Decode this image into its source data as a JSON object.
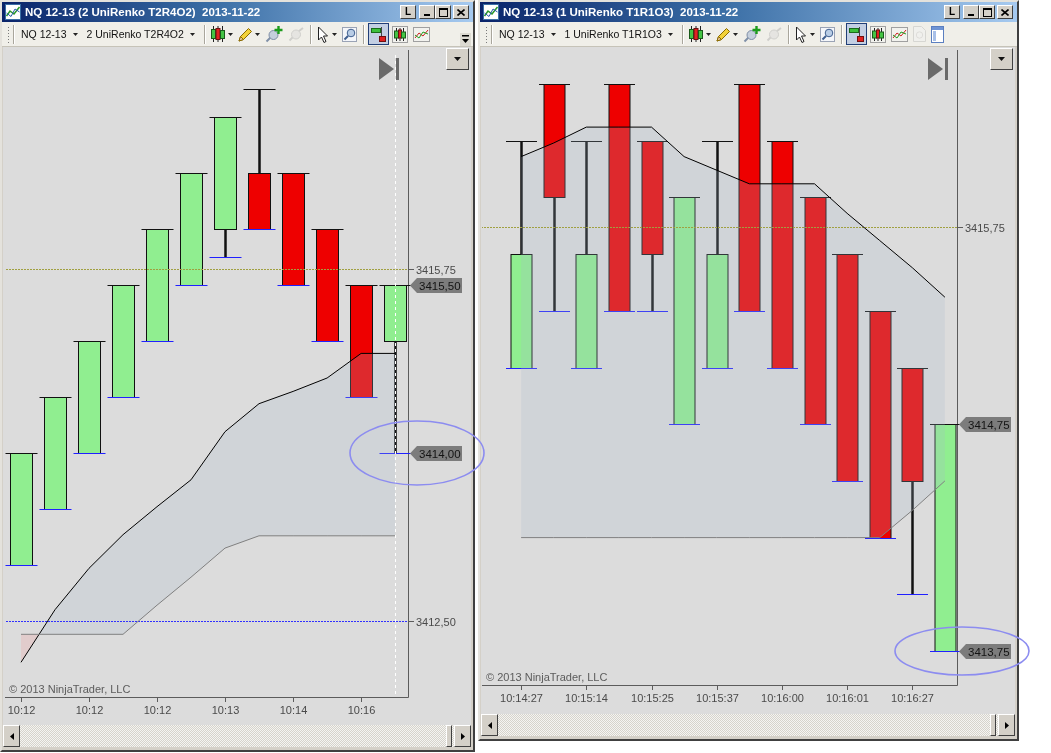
{
  "windows": [
    {
      "title": "NQ 12-13 (2 UniRenko T2R4O2)  2013-11-22",
      "title_buttons": [
        {
          "kind": "link",
          "label": "L"
        },
        {
          "kind": "minimize"
        },
        {
          "kind": "maximize"
        },
        {
          "kind": "close"
        }
      ],
      "toolbar": {
        "instrument": "NQ 12-13",
        "bar_type": "2 UniRenko T2R4O2",
        "tool_groups": [
          [
            {
              "kind": "chart-style",
              "dropdown": true,
              "selected": false,
              "disabled": false
            },
            {
              "kind": "drawing-tool",
              "dropdown": true,
              "selected": false,
              "disabled": false
            },
            {
              "kind": "add-indicator",
              "dropdown": false,
              "selected": false,
              "disabled": false
            },
            {
              "kind": "remove-indicator",
              "dropdown": false,
              "selected": false,
              "disabled": true
            }
          ],
          [
            {
              "kind": "pointer",
              "dropdown": true,
              "selected": false,
              "disabled": false
            },
            {
              "kind": "zoom",
              "dropdown": false,
              "selected": false,
              "disabled": false
            }
          ],
          [
            {
              "kind": "price-markers",
              "dropdown": false,
              "selected": true,
              "disabled": false
            },
            {
              "kind": "bar-chart",
              "dropdown": false,
              "selected": false,
              "disabled": false
            },
            {
              "kind": "line-chart",
              "dropdown": false,
              "selected": false,
              "disabled": false
            }
          ]
        ],
        "overflow_button": true
      },
      "chart": {
        "price_levels": [
          {
            "label": "3415,75",
            "color": "#a0a040"
          },
          {
            "label": "3412,50",
            "color": "#3030ff"
          }
        ],
        "price_markers": [
          "3415,50",
          "3414,00"
        ],
        "time_labels": [
          "10:12",
          "10:12",
          "10:12",
          "10:13",
          "10:14",
          "10:16"
        ],
        "copyright": "© 2013 NinjaTrader, LLC"
      }
    },
    {
      "title": "NQ 12-13 (1 UniRenko T1R1O3)  2013-11-22",
      "title_buttons": [
        {
          "kind": "link",
          "label": "L"
        },
        {
          "kind": "minimize"
        },
        {
          "kind": "maximize"
        },
        {
          "kind": "close"
        }
      ],
      "toolbar": {
        "instrument": "NQ 12-13",
        "bar_type": "1 UniRenko T1R1O3",
        "tool_groups": [
          [
            {
              "kind": "chart-style",
              "dropdown": true,
              "selected": false,
              "disabled": false
            },
            {
              "kind": "drawing-tool",
              "dropdown": true,
              "selected": false,
              "disabled": false
            },
            {
              "kind": "add-indicator",
              "dropdown": false,
              "selected": false,
              "disabled": false
            },
            {
              "kind": "remove-indicator",
              "dropdown": false,
              "selected": false,
              "disabled": true
            }
          ],
          [
            {
              "kind": "pointer",
              "dropdown": true,
              "selected": false,
              "disabled": false
            },
            {
              "kind": "zoom",
              "dropdown": false,
              "selected": false,
              "disabled": false
            }
          ],
          [
            {
              "kind": "price-markers",
              "dropdown": false,
              "selected": true,
              "disabled": false
            },
            {
              "kind": "bar-chart",
              "dropdown": false,
              "selected": false,
              "disabled": false
            },
            {
              "kind": "line-chart",
              "dropdown": false,
              "selected": false,
              "disabled": false
            },
            {
              "kind": "document",
              "dropdown": false,
              "selected": false,
              "disabled": true
            },
            {
              "kind": "panel",
              "dropdown": false,
              "selected": false,
              "disabled": false
            }
          ]
        ],
        "overflow_button": false
      },
      "chart": {
        "price_levels": [
          {
            "label": "3415,75",
            "color": "#a0a040"
          }
        ],
        "price_markers": [
          "3414,75",
          "3413,75"
        ],
        "time_labels": [
          "10:14:27",
          "10:15:14",
          "10:15:25",
          "10:15:37",
          "10:16:00",
          "10:16:01",
          "10:16:27"
        ],
        "copyright": "© 2013 NinjaTrader, LLC"
      }
    }
  ]
}
